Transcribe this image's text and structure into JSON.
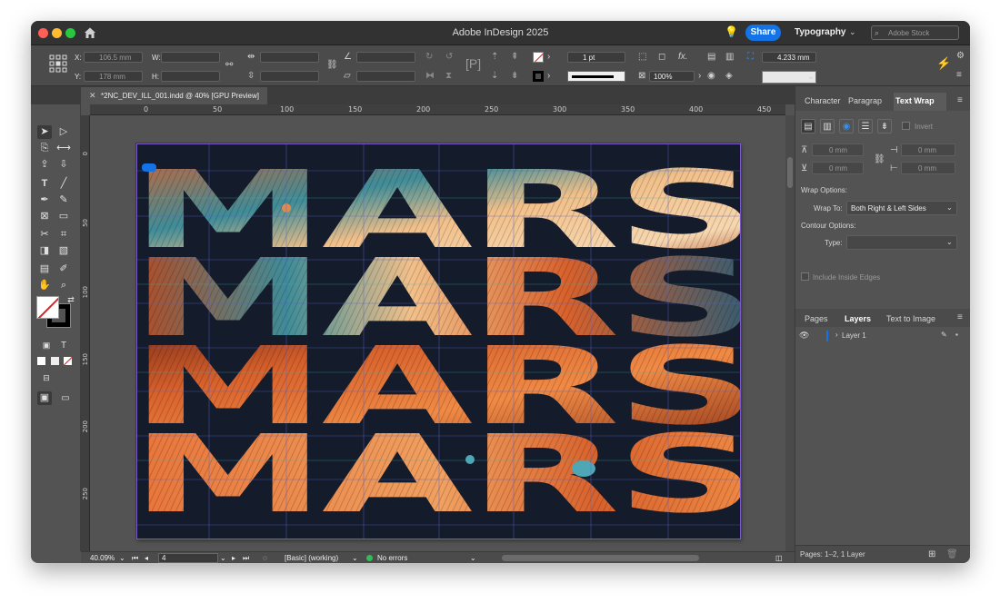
{
  "window": {
    "title": "Adobe InDesign 2025",
    "share_label": "Share",
    "workspace": "Typography",
    "search_placeholder": "Adobe Stock"
  },
  "control": {
    "x_label": "X:",
    "x_value": "106.5 mm",
    "y_label": "Y:",
    "y_value": "178 mm",
    "w_label": "W:",
    "h_label": "H:",
    "stroke_weight": "1 pt",
    "opacity": "100%",
    "size_value": "4.233 mm",
    "fx_label": "fx."
  },
  "doc_tab": {
    "label": "*2NC_DEV_ILL_001.indd @ 40% [GPU Preview]"
  },
  "ruler": {
    "h_ticks": [
      "0",
      "50",
      "100",
      "150",
      "200",
      "250",
      "300",
      "350",
      "400",
      "450"
    ],
    "v_ticks": [
      "0",
      "50",
      "100",
      "150",
      "200",
      "250"
    ]
  },
  "artwork": {
    "rows": [
      "MARS",
      "MARS",
      "MARS",
      "MARS"
    ],
    "colors": {
      "bg": "#141b2b",
      "orange": "#d8612c",
      "peach": "#f2c08a",
      "teal": "#3f8c98",
      "rust": "#a8401f",
      "dark": "#131a26",
      "guide": "#5a64c8"
    }
  },
  "status": {
    "zoom": "40.09%",
    "page": "4",
    "style": "[Basic] (working)",
    "errors": "No errors"
  },
  "panel": {
    "tabs": [
      "Character",
      "Paragrap",
      "Text Wrap"
    ],
    "invert_label": "Invert",
    "offset_top": "0 mm",
    "offset_left": "0 mm",
    "offset_bottom": "0 mm",
    "offset_right": "0 mm",
    "wrap_options_label": "Wrap Options:",
    "wrap_to_label": "Wrap To:",
    "wrap_to_value": "Both Right & Left Sides",
    "contour_label": "Contour Options:",
    "type_label": "Type:",
    "include_label": "Include Inside Edges",
    "lower_tabs": [
      "Pages",
      "Layers",
      "Text to Image"
    ],
    "layer_name": "Layer 1",
    "footer": "Pages: 1–2, 1 Layer"
  }
}
